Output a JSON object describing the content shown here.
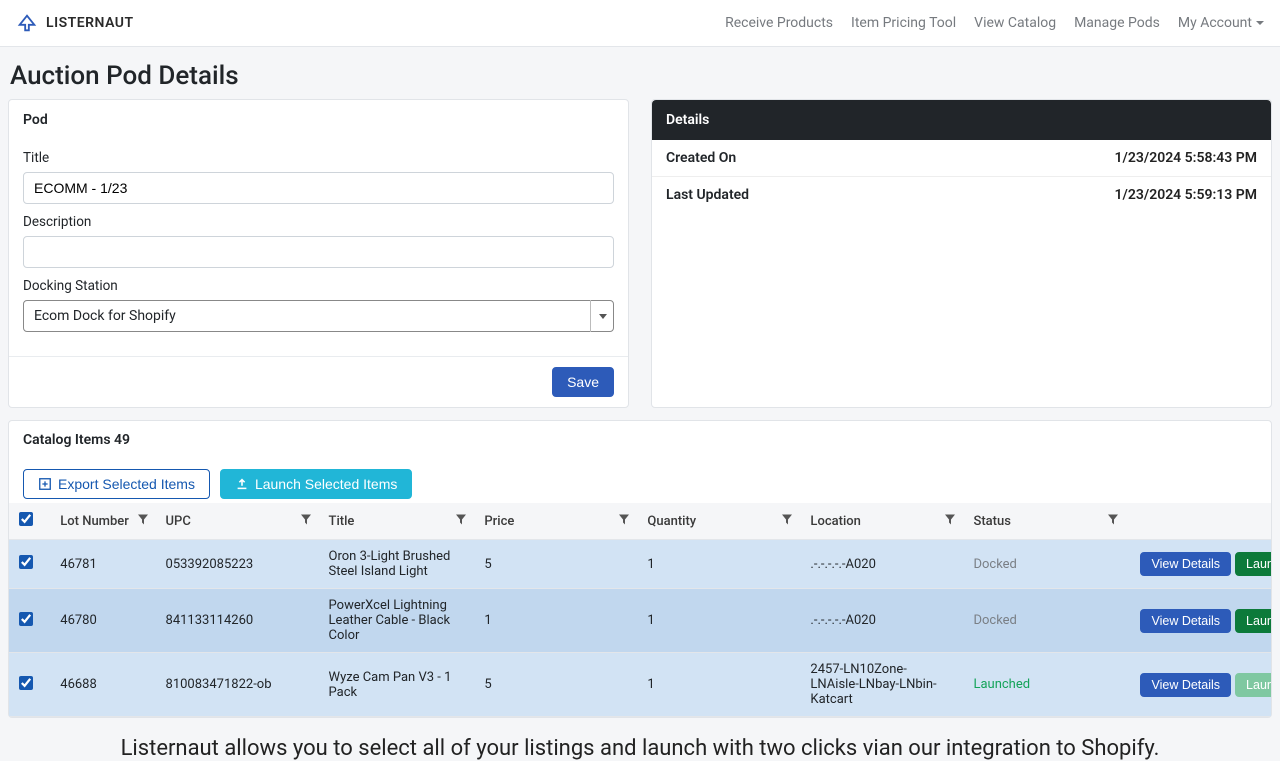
{
  "brand": {
    "name": "LISTERNAUT"
  },
  "nav": {
    "items": [
      {
        "label": "Receive Products"
      },
      {
        "label": "Item Pricing Tool"
      },
      {
        "label": "View Catalog"
      },
      {
        "label": "Manage Pods"
      },
      {
        "label": "My Account",
        "dropdown": true
      }
    ]
  },
  "page": {
    "title": "Auction Pod Details"
  },
  "pod": {
    "section_title": "Pod",
    "title_label": "Title",
    "title_value": "ECOMM - 1/23",
    "description_label": "Description",
    "description_value": "",
    "docking_label": "Docking Station",
    "docking_value": "Ecom Dock for Shopify",
    "save_label": "Save"
  },
  "details": {
    "section_title": "Details",
    "created_label": "Created On",
    "created_value": "1/23/2024 5:58:43 PM",
    "updated_label": "Last Updated",
    "updated_value": "1/23/2024 5:59:13 PM"
  },
  "catalog": {
    "header": "Catalog Items 49",
    "export_label": "Export Selected Items",
    "launch_label": "Launch Selected Items",
    "columns": {
      "lot": "Lot Number",
      "upc": "UPC",
      "title": "Title",
      "price": "Price",
      "qty": "Quantity",
      "loc": "Location",
      "status": "Status"
    },
    "view_details_label": "View Details",
    "launch_row_label": "Launch",
    "rows": [
      {
        "lot": "46781",
        "upc": "053392085223",
        "title": "Oron 3-Light Brushed Steel Island Light",
        "price": "5",
        "qty": "1",
        "loc": ".-.-.-.-.-A020",
        "status": "Docked"
      },
      {
        "lot": "46780",
        "upc": "841133114260",
        "title": "PowerXcel Lightning Leather Cable - Black Color",
        "price": "1",
        "qty": "1",
        "loc": ".-.-.-.-.-A020",
        "status": "Docked"
      },
      {
        "lot": "46688",
        "upc": "810083471822-ob",
        "title": "Wyze Cam Pan V3 - 1 Pack",
        "price": "5",
        "qty": "1",
        "loc": "2457-LN10Zone-LNAisle-LNbay-LNbin-Katcart",
        "status": "Launched"
      }
    ]
  },
  "caption": "Listernaut allows you to select all of your listings and launch with two clicks vian our integration to Shopify."
}
